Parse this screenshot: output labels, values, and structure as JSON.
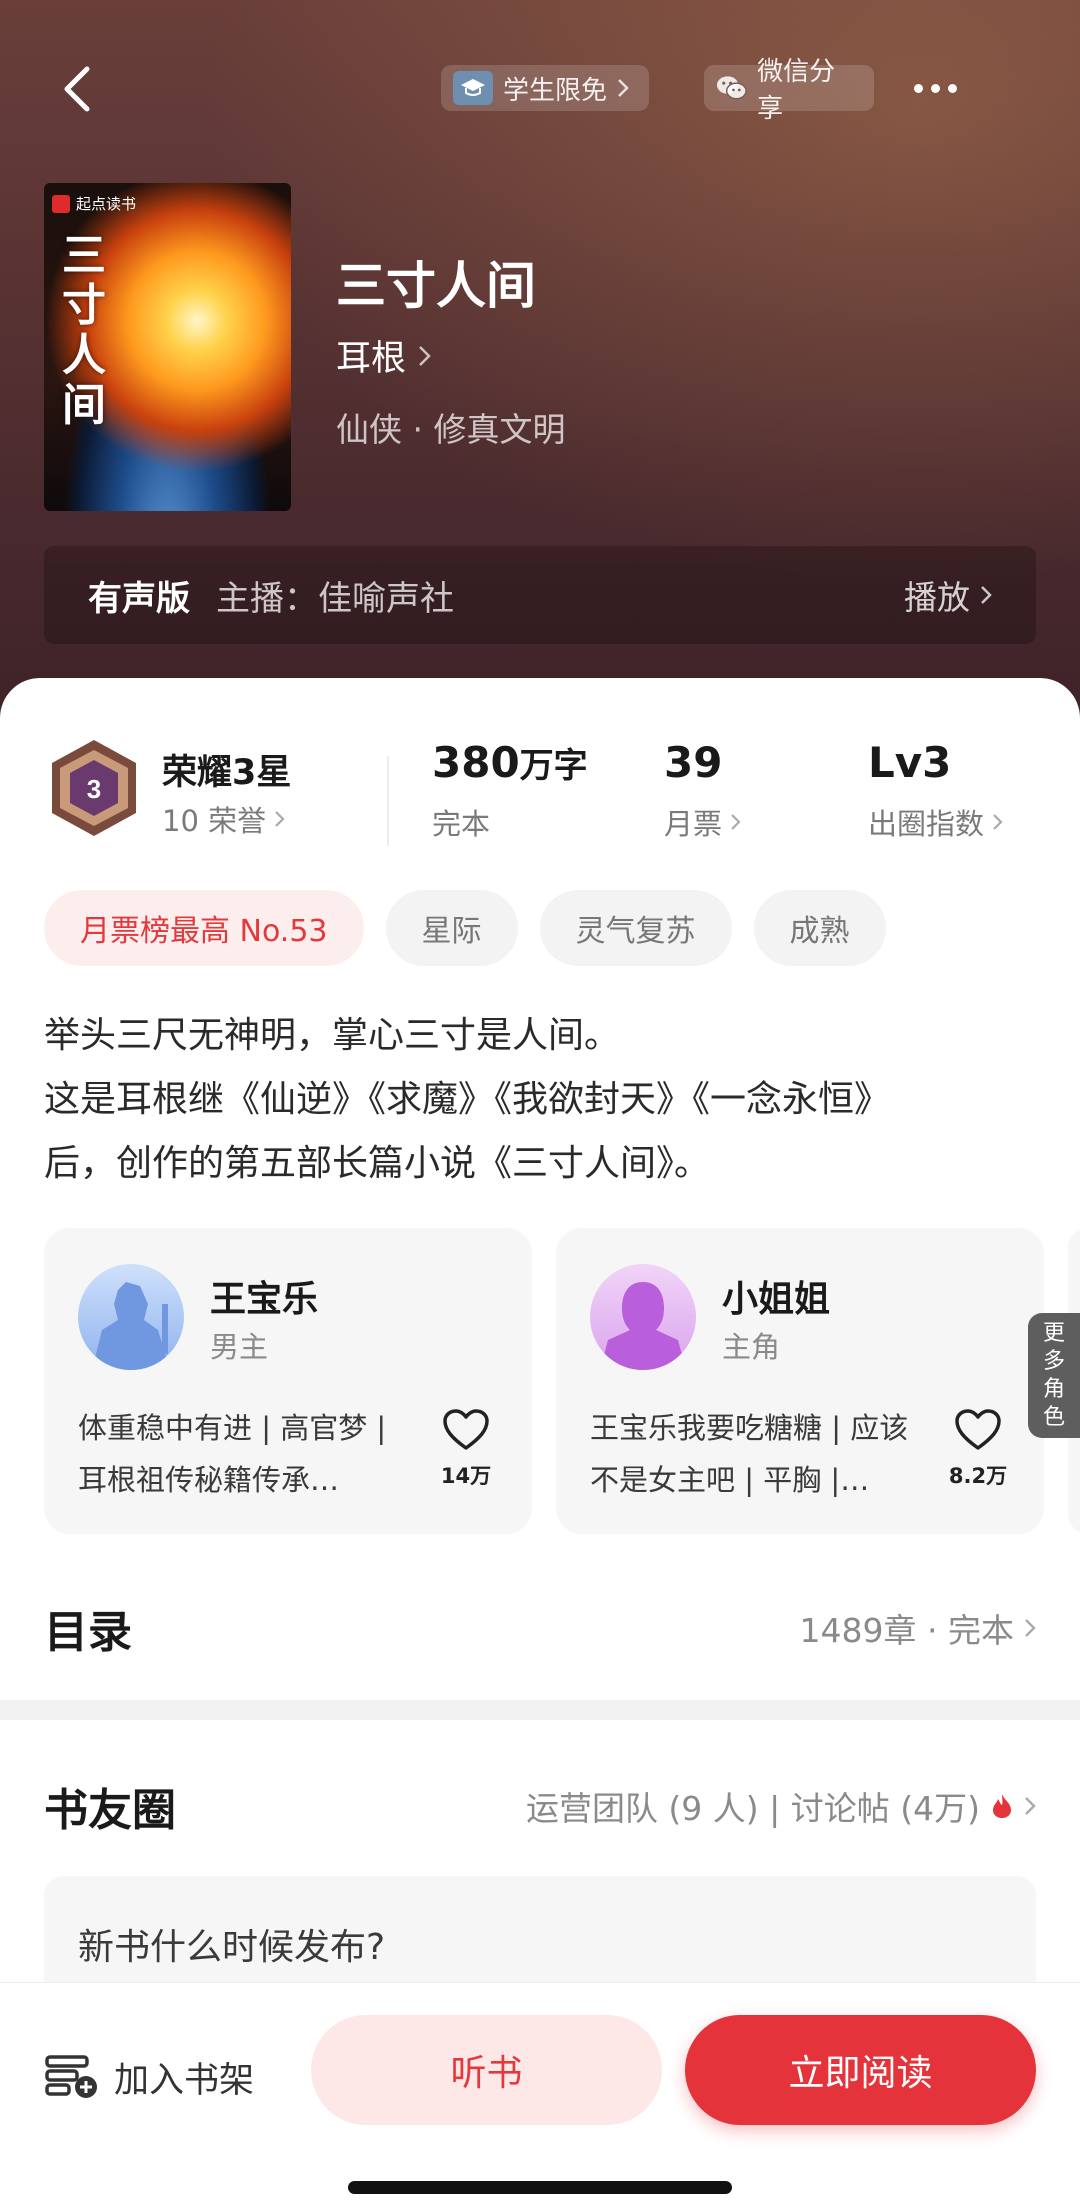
{
  "header": {
    "student_free": "学生限免",
    "wechat_share": "微信分享"
  },
  "book": {
    "cover_brand": "起点读书",
    "cover_title": "三寸人间",
    "title": "三寸人间",
    "author": "耳根",
    "genre": "仙侠 · 修真文明"
  },
  "audio": {
    "label": "有声版",
    "host": "主播：佳喻声社",
    "play": "播放"
  },
  "stats": {
    "honor_title": "荣耀3星",
    "honor_level": "3",
    "honor_sub": "10 荣誉",
    "words_value": "380",
    "words_unit": "万字",
    "words_label": "完本",
    "tickets_value": "39",
    "tickets_label": "月票",
    "circle_value": "Lv3",
    "circle_label": "出圈指数"
  },
  "tags": [
    "月票榜最高 No.53",
    "星际",
    "灵气复苏",
    "成熟"
  ],
  "description": [
    "举头三尺无神明，掌心三寸是人间。",
    "这是耳根继《仙逆》《求魔》《我欲封天》《一念永恒》",
    "后，创作的第五部长篇小说《三寸人间》。"
  ],
  "characters": [
    {
      "name": "王宝乐",
      "role": "男主",
      "desc": "体重稳中有进 | 高官梦 | 耳根祖传秘籍传承…",
      "likes": "14万"
    },
    {
      "name": "小姐姐",
      "role": "主角",
      "desc": "王宝乐我要吃糖糖 | 应该不是女主吧 | 平胸 |…",
      "likes": "8.2万"
    }
  ],
  "more_roles": "更多角色",
  "toc": {
    "title": "目录",
    "info": "1489章 · 完本"
  },
  "circle": {
    "title": "书友圈",
    "info": "运营团队 (9 人) | 讨论帖 (4万)",
    "post": "新书什么时候发布?"
  },
  "bottom": {
    "shelf": "加入书架",
    "listen": "听书",
    "read": "立即阅读"
  },
  "colors": {
    "accent": "#e4333a",
    "hero_bg": "#5a3434"
  }
}
